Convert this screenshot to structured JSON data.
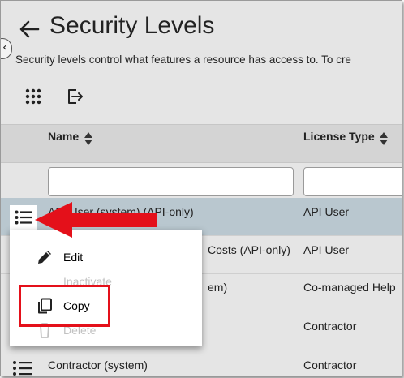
{
  "page": {
    "title": "Security Levels",
    "description": "Security levels control what features a resource has access to. To cre"
  },
  "toolbar": {
    "columns_icon": "grid-icon",
    "export_icon": "export-icon"
  },
  "table": {
    "columns": [
      {
        "label": "Name"
      },
      {
        "label": "License Type"
      }
    ],
    "filters": [
      {
        "value": "",
        "placeholder": ""
      },
      {
        "value": "",
        "placeholder": ""
      }
    ],
    "rows": [
      {
        "name": "API User (system) (API-only)",
        "license": "API User"
      },
      {
        "name": "Costs (API-only)",
        "license": "API User"
      },
      {
        "name": "em)",
        "license": "Co-managed Help"
      },
      {
        "name": "",
        "license": "Contractor"
      },
      {
        "name": "Contractor (system)",
        "license": "Contractor"
      }
    ]
  },
  "context_menu": {
    "items": [
      {
        "label": "Edit",
        "icon": "pencil-icon",
        "enabled": true
      },
      {
        "label": "Inactivate",
        "icon": "",
        "enabled": false
      },
      {
        "label": "Copy",
        "icon": "copy-icon",
        "enabled": true
      },
      {
        "label": "Delete",
        "icon": "trash-icon",
        "enabled": false
      }
    ]
  },
  "annotation": {
    "highlight_color": "#e4101a",
    "row_highlight_color": "#b9c7cf"
  }
}
